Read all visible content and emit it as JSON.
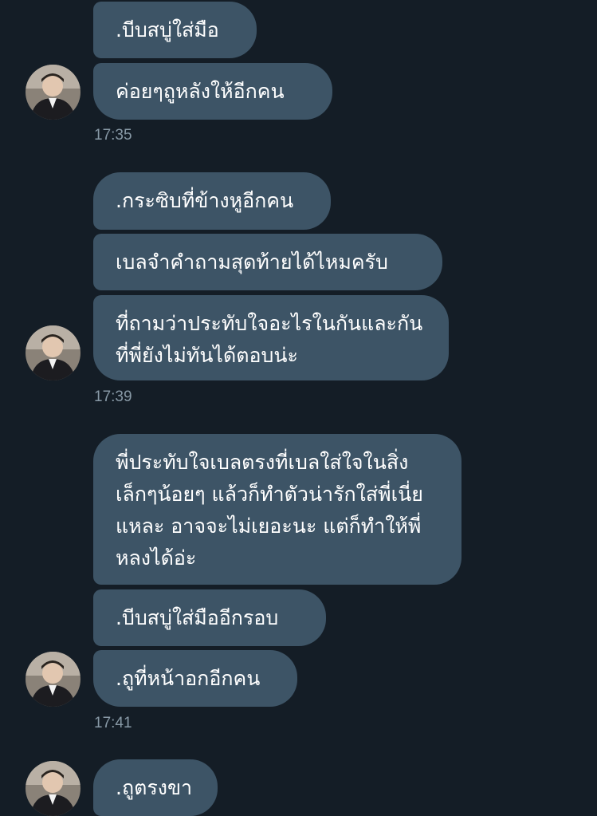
{
  "messages": [
    {
      "text": ".บีบสบู่ใส่มือ"
    },
    {
      "text": "ค่อยๆถูหลังให้อีกคน"
    },
    {
      "text": ".กระซิบที่ข้างหูอีกคน"
    },
    {
      "text": "เบลจำคำถามสุดท้ายได้ไหมครับ"
    },
    {
      "text": "ที่ถามว่าประทับใจอะไรในกันและกัน ที่พี่ยังไม่ทันได้ตอบน่ะ"
    },
    {
      "text": "พี่ประทับใจเบลตรงที่เบลใส่ใจในสิ่งเล็กๆน้อยๆ แล้วก็ทำตัวน่ารักใส่พี่เนี่ยแหละ อาจจะไม่เยอะนะ แต่ก็ทำให้พี่หลงได้อ่ะ"
    },
    {
      "text": ".บีบสบู่ใส่มืออีกรอบ"
    },
    {
      "text": ".ถูที่หน้าอกอีกคน"
    },
    {
      "text": ".ถูตรงขา"
    }
  ],
  "timestamps": [
    "17:35",
    "17:39",
    "17:41"
  ],
  "avatar_icon": "user-profile-photo",
  "colors": {
    "background": "#141d26",
    "bubble": "#3d5466",
    "text": "#ffffff",
    "timestamp": "#8899a6"
  }
}
